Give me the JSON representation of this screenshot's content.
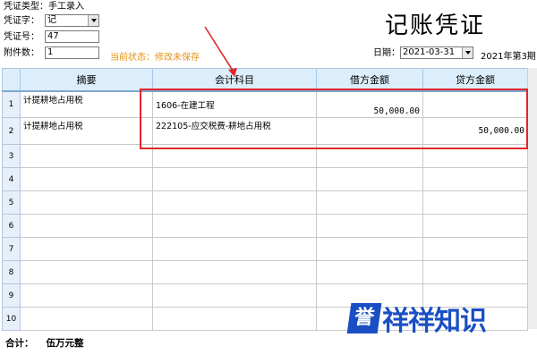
{
  "header": {
    "voucher_type_label": "凭证类型：",
    "voucher_type_value": "手工录入",
    "voucher_word_label": "凭证字：",
    "voucher_word_value": "记",
    "voucher_no_label": "凭证号：",
    "voucher_no_value": "47",
    "attachments_label": "附件数：",
    "attachments_value": "1",
    "status_text": "当前状态：修改未保存",
    "title": "记账凭证",
    "date_label": "日期：",
    "date_value": "2021-03-31",
    "period_text": "2021年第3期"
  },
  "table": {
    "columns": [
      "摘要",
      "会计科目",
      "借方金额",
      "贷方金额"
    ],
    "rows": [
      {
        "num": "1",
        "summary": "计提耕地占用税",
        "account": "1606-在建工程",
        "debit": "50,000.00",
        "credit": ""
      },
      {
        "num": "2",
        "summary": "计提耕地占用税",
        "account": "222105-应交税费-耕地占用税",
        "debit": "",
        "credit": "50,000.00"
      },
      {
        "num": "3",
        "summary": "",
        "account": "",
        "debit": "",
        "credit": ""
      },
      {
        "num": "4",
        "summary": "",
        "account": "",
        "debit": "",
        "credit": ""
      },
      {
        "num": "5",
        "summary": "",
        "account": "",
        "debit": "",
        "credit": ""
      },
      {
        "num": "6",
        "summary": "",
        "account": "",
        "debit": "",
        "credit": ""
      },
      {
        "num": "7",
        "summary": "",
        "account": "",
        "debit": "",
        "credit": ""
      },
      {
        "num": "8",
        "summary": "",
        "account": "",
        "debit": "",
        "credit": ""
      },
      {
        "num": "9",
        "summary": "",
        "account": "",
        "debit": "",
        "credit": ""
      },
      {
        "num": "10",
        "summary": "",
        "account": "",
        "debit": "",
        "credit": ""
      }
    ]
  },
  "footer": {
    "total_label": "合计：",
    "total_value": "伍万元整"
  },
  "watermark": {
    "box_char": "誉",
    "text": "祥祥知识"
  },
  "colors": {
    "highlight_red": "#e0262b",
    "status_orange": "#e8900c",
    "header_blue": "#dceefc",
    "brand_blue": "#1a4fc4"
  }
}
